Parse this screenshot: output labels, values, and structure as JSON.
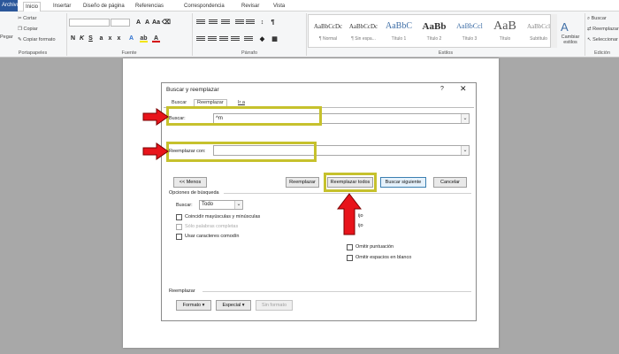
{
  "ribbon": {
    "tabs": [
      "Archivo",
      "Inicio",
      "Insertar",
      "Diseño de página",
      "Referencias",
      "Correspondencia",
      "Revisar",
      "Vista"
    ],
    "clipboard": {
      "paste_label": "Pegar",
      "cut": "Cortar",
      "copy": "Copiar",
      "format_painter": "Copiar formato",
      "group_label": "Portapapeles"
    },
    "font": {
      "font_name": "",
      "font_size": "",
      "group_label": "Fuente"
    },
    "paragraph": {
      "group_label": "Párrafo"
    },
    "styles": {
      "group_label": "Estilos",
      "items": [
        {
          "sample": "AaBbCcDc",
          "name": "¶ Normal"
        },
        {
          "sample": "AaBbCcDc",
          "name": "¶ Sin espa..."
        },
        {
          "sample": "AaBbC",
          "name": "Título 1"
        },
        {
          "sample": "AaBb",
          "name": "Título 2"
        },
        {
          "sample": "AaBbCcl",
          "name": "Título 3"
        },
        {
          "sample": "AaB",
          "name": "Título"
        },
        {
          "sample": "AaBbCcl",
          "name": "Subtítulo"
        }
      ],
      "change_styles": "Cambiar estilos"
    },
    "editing": {
      "find": "Buscar",
      "replace": "Reemplazar",
      "select": "Seleccionar",
      "group_label": "Edición"
    }
  },
  "dialog": {
    "title": "Buscar y reemplazar",
    "help": "?",
    "close": "✕",
    "tabs": [
      "Buscar",
      "Reemplazar",
      "Ir a"
    ],
    "find_label": "Buscar:",
    "find_value": "^m",
    "replace_label": "Reemplazar con:",
    "replace_value": "",
    "buttons": {
      "less": "<< Menos",
      "replace": "Reemplazar",
      "replace_all": "Reemplazar todos",
      "find_next": "Buscar siguiente",
      "cancel": "Cancelar"
    },
    "search_options_label": "Opciones de búsqueda",
    "search_label": "Buscar:",
    "search_scope": "Todo",
    "options": [
      {
        "label": "Coincidir mayúsculas y minúsculas",
        "enabled": true
      },
      {
        "label": "Sólo palabras completas",
        "enabled": false
      },
      {
        "label": "Usar caracteres comodín",
        "enabled": true
      }
    ],
    "right_options": [
      {
        "label": "Omitir puntuación"
      },
      {
        "label": "Omitir espacios en blanco"
      }
    ],
    "partial_labels": [
      "ijo",
      "ijo"
    ],
    "replace_section_label": "Reemplazar",
    "bottom_buttons": {
      "format": "Formato",
      "special": "Especial",
      "no_format": "Sin formato"
    }
  },
  "colors": {
    "highlight": "#c6c12d",
    "arrow_red": "#e8141b",
    "file_tab": "#2b579a"
  }
}
